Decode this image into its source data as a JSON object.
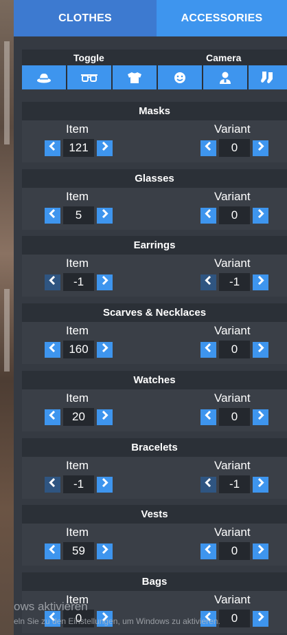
{
  "tabs": {
    "clothes": "CLOTHES",
    "accessories": "ACCESSORIES"
  },
  "toggle": {
    "toggle_label": "Toggle",
    "camera_label": "Camera",
    "buttons": [
      "hat-icon",
      "glasses-icon",
      "shirt-icon",
      "face-icon",
      "person-icon",
      "socks-icon"
    ]
  },
  "labels": {
    "item": "Item",
    "variant": "Variant"
  },
  "sections": [
    {
      "title": "Masks",
      "item": "121",
      "variant": "0"
    },
    {
      "title": "Glasses",
      "item": "5",
      "variant": "0"
    },
    {
      "title": "Earrings",
      "item": "-1",
      "variant": "-1"
    },
    {
      "title": "Scarves & Necklaces",
      "item": "160",
      "variant": "0"
    },
    {
      "title": "Watches",
      "item": "20",
      "variant": "0"
    },
    {
      "title": "Bracelets",
      "item": "-1",
      "variant": "-1"
    },
    {
      "title": "Vests",
      "item": "59",
      "variant": "0"
    },
    {
      "title": "Bags",
      "item": "0",
      "variant": "0"
    }
  ],
  "watermark": {
    "line1": "ows aktivieren",
    "line2": "eln Sie zu den Einstellungen, um Windows zu aktivieren."
  },
  "colors": {
    "accent": "#3e95ee",
    "tab_active": "#3d7ad0",
    "panel": "#353a42"
  }
}
